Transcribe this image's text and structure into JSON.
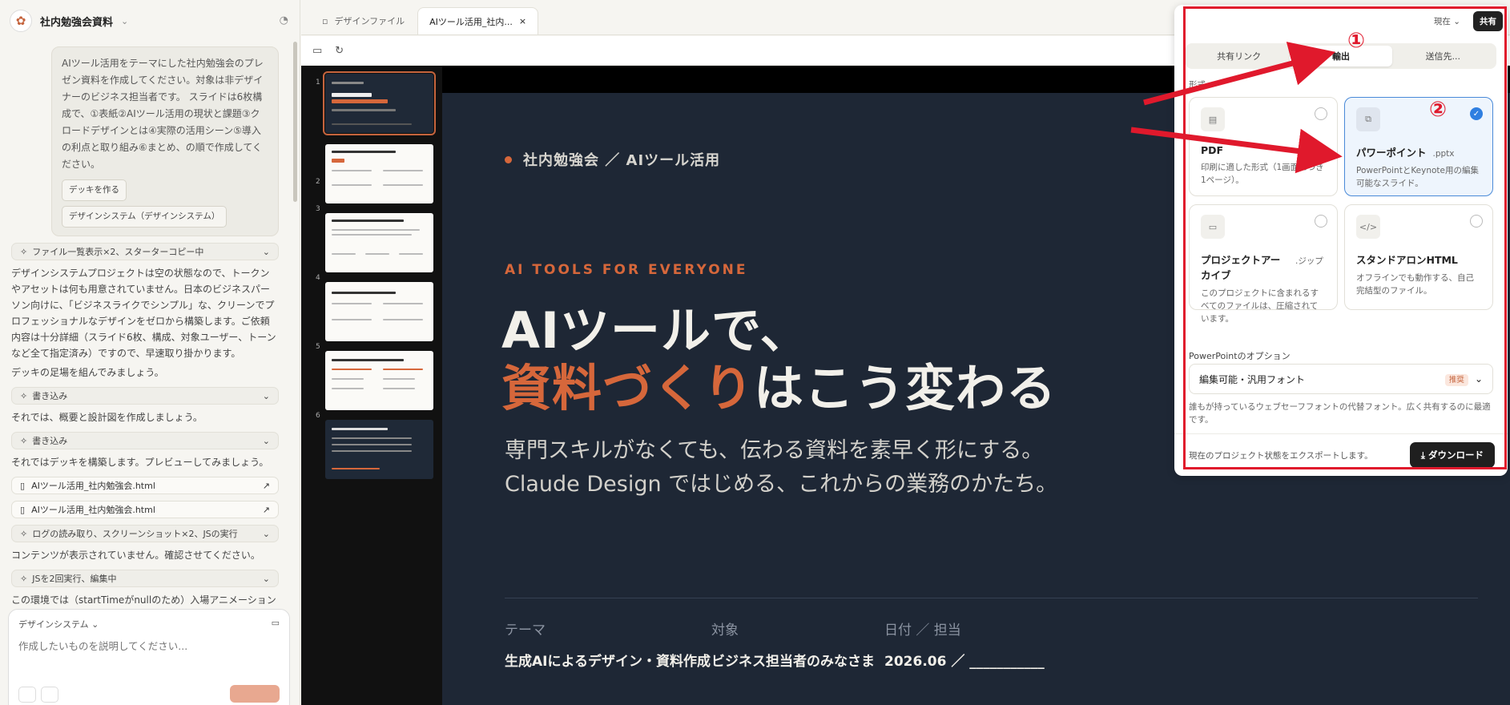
{
  "app": {
    "project_title": "社内勉強会資料"
  },
  "chat": {
    "user_message": "AIツール活用をテーマにした社内勉強会のプレゼン資料を作成してください。対象は非デザイナーのビジネス担当者です。 スライドは6枚構成で、①表紙②AIツール活用の現状と課題③クロードデザインとは④実際の活用シーン⑤導入の利点と取り組み⑥まとめ、の順で作成してください。",
    "pills": [
      "デッキを作る",
      "デザインシステム（デザインシステム）"
    ],
    "tool1": "ファイル一覧表示×2、スターターコピー中",
    "text1": "デザインシステムプロジェクトは空の状態なので、トークンやアセットは何も用意されていません。日本のビジネスパーソン向けに、「ビジネスライクでシンプル」な、クリーンでプロフェッショナルなデザインをゼロから構築します。ご依頼内容は十分詳細（スライド6枚、構成、対象ユーザー、トーンなど全て指定済み）ですので、早速取り掛かります。",
    "text2": "デッキの足場を組んでみましょう。",
    "tool2": "書き込み",
    "text3": "それでは、概要と設計図を作成しましょう。",
    "tool3": "書き込み",
    "text4": "それではデッキを構築します。プレビューしてみましょう。",
    "file1": "AIツール活用_社内勉強会.html",
    "file2": "AIツール活用_社内勉強会.html",
    "tool4": "ログの読み取り、スクリーンショット×2、JSの実行",
    "text5": "コンテンツが表示されていません。確認させてください。",
    "tool5": "JSを2回実行、編集中",
    "text6": "この環境では（startTimeがnullのため）入場アニメーションが",
    "composer_ds": "デザインシステム",
    "composer_placeholder": "作成したいものを説明してください..."
  },
  "tabs": [
    {
      "label": "デザインファイル"
    },
    {
      "label": "AIツール活用_社内...",
      "close": "×"
    }
  ],
  "thumbnails": [
    "1",
    "2",
    "3",
    "4",
    "5",
    "6"
  ],
  "slide": {
    "kicker": "社内勉強会 ／ AIツール活用",
    "eyebrow": "AI TOOLS FOR EVERYONE",
    "title_line1": "AIツールで、",
    "title_accent": "資料づくり",
    "title_rest": "はこう変わる",
    "subtitle_line1": "専門スキルがなくても、伝わる資料を素早く形にする。",
    "subtitle_line2": "Claude Design ではじめる、これからの業務のかたち。",
    "meta": [
      {
        "label": "テーマ",
        "value": "生成AIによるデザイン・資料作成"
      },
      {
        "label": "対象",
        "value": "ビジネス担当者のみなさま"
      },
      {
        "label": "日付 ／ 担当",
        "value": "2026.06 ／ ___________"
      }
    ]
  },
  "share": {
    "version": "現在",
    "share_button": "共有",
    "segments": [
      "共有リンク",
      "輸出",
      "送信先..."
    ],
    "format_label": "形式",
    "formats": [
      {
        "title": "PDF",
        "ext": "",
        "desc": "印刷に適した形式（1画面につき1ページ）。"
      },
      {
        "title": "パワーポイント",
        "ext": ".pptx",
        "desc": "PowerPointとKeynote用の編集可能なスライド。"
      },
      {
        "title": "プロジェクトアーカイブ",
        "ext": ".ジップ",
        "desc": "このプロジェクトに含まれるすべてのファイルは、圧縮されています。"
      },
      {
        "title": "スタンドアロンHTML",
        "ext": "",
        "desc": "オフラインでも動作する、自己完結型のファイル。"
      }
    ],
    "selected_format": "パワーポイント",
    "options_label": "PowerPointのオプション",
    "option_value": "編集可能・汎用フォント",
    "option_badge": "推奨",
    "option_desc": "誰もが持っているウェブセーフフォントの代替フォント。広く共有するのに最適です。",
    "footer_text": "現在のプロジェクト状態をエクスポートします。",
    "download": "ダウンロード"
  },
  "annotations": {
    "n1": "①",
    "n2": "②"
  },
  "colors": {
    "accent": "#d6673b",
    "slide_bg": "#1e2735",
    "annotation": "#e0192c",
    "selected": "#2f7fe1"
  }
}
